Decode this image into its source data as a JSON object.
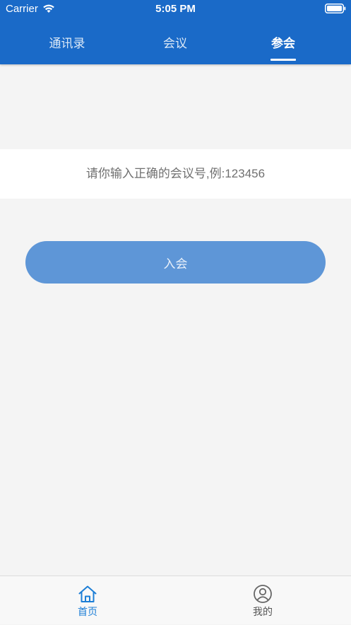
{
  "colors": {
    "brand": "#1a6ac8",
    "button": "#5e96d7",
    "active_bottom": "#1c7ed6"
  },
  "status_bar": {
    "carrier": "Carrier",
    "time": "5:05 PM"
  },
  "tabs": [
    {
      "label": "通讯录",
      "active": false
    },
    {
      "label": "会议",
      "active": false
    },
    {
      "label": "参会",
      "active": true
    }
  ],
  "meeting_input": {
    "value": "",
    "placeholder": "请你输入正确的会议号,例:123456"
  },
  "join_button": {
    "label": "入会"
  },
  "bottom_nav": [
    {
      "label": "首页",
      "icon": "home-icon",
      "active": true
    },
    {
      "label": "我的",
      "icon": "user-icon",
      "active": false
    }
  ]
}
